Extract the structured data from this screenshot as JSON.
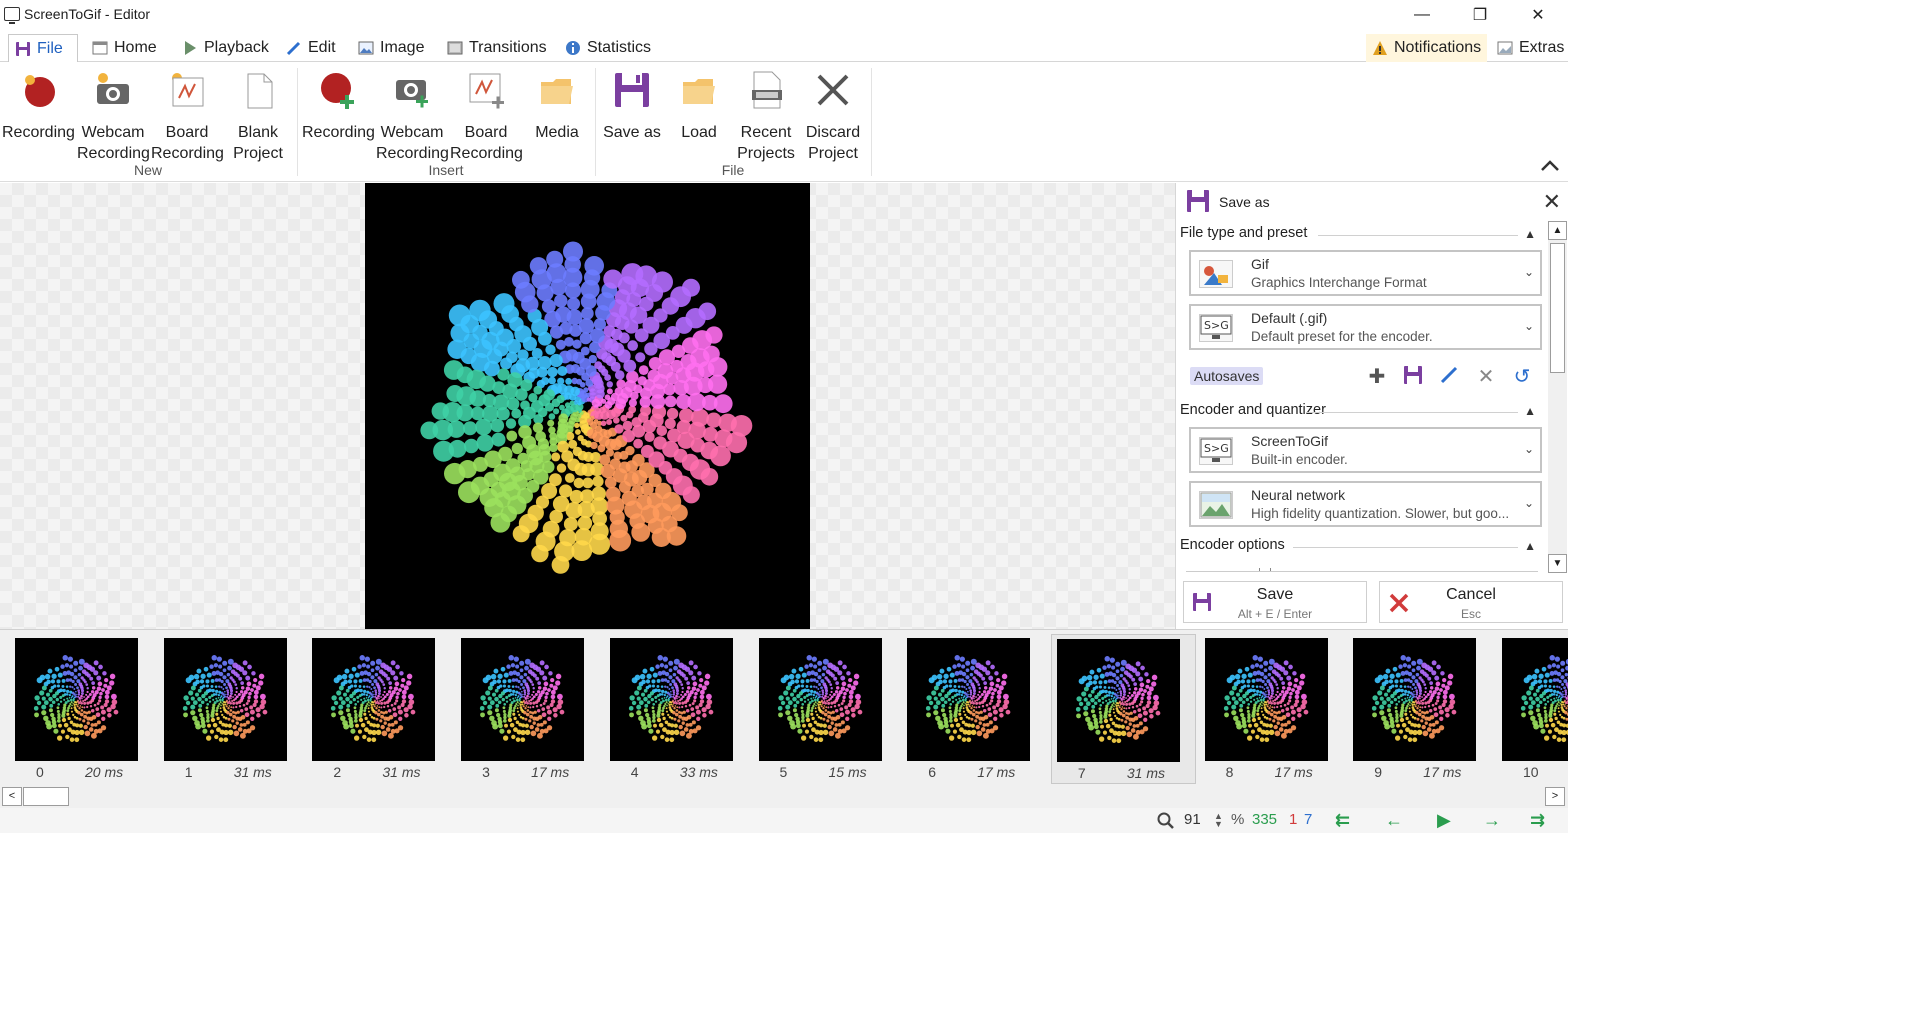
{
  "window": {
    "title": "ScreenToGif - Editor",
    "controls": [
      "—",
      "❐",
      "✕"
    ]
  },
  "tabs": [
    {
      "label": "File",
      "icon": "floppy-disk-icon"
    },
    {
      "label": "Home",
      "icon": "window-icon"
    },
    {
      "label": "Playback",
      "icon": "play-icon"
    },
    {
      "label": "Edit",
      "icon": "pencil-icon"
    },
    {
      "label": "Image",
      "icon": "image-icon"
    },
    {
      "label": "Transitions",
      "icon": "transition-icon"
    },
    {
      "label": "Statistics",
      "icon": "info-icon"
    }
  ],
  "header_right": {
    "notifications": "Notifications",
    "extras": "Extras"
  },
  "ribbon": {
    "new_group": "New",
    "insert_group": "Insert",
    "file_group": "File",
    "new": [
      {
        "l1": "Recording",
        "l2": ""
      },
      {
        "l1": "Webcam",
        "l2": "Recording"
      },
      {
        "l1": "Board",
        "l2": "Recording"
      },
      {
        "l1": "Blank",
        "l2": "Project"
      }
    ],
    "insert": [
      {
        "l1": "Recording",
        "l2": ""
      },
      {
        "l1": "Webcam",
        "l2": "Recording"
      },
      {
        "l1": "Board",
        "l2": "Recording"
      },
      {
        "l1": "Media",
        "l2": ""
      }
    ],
    "file": [
      {
        "l1": "Save as",
        "l2": ""
      },
      {
        "l1": "Load",
        "l2": ""
      },
      {
        "l1": "Recent",
        "l2": "Projects"
      },
      {
        "l1": "Discard",
        "l2": "Project"
      }
    ]
  },
  "panel": {
    "title": "Save as",
    "file_type_section": "File type and preset",
    "file_type": {
      "name": "Gif",
      "desc": "Graphics Interchange Format"
    },
    "preset": {
      "name": "Default (.gif)",
      "desc": "Default preset for the encoder."
    },
    "autosaves": "Autosaves",
    "encoder_section": "Encoder and quantizer",
    "encoder": {
      "name": "ScreenToGif",
      "desc": "Built-in encoder."
    },
    "quantizer": {
      "name": "Neural network",
      "desc": "High fidelity quantization. Slower, but goo..."
    },
    "encoder_options_section": "Encoder options",
    "save": {
      "label": "Save",
      "shortcut": "Alt + E / Enter"
    },
    "cancel": {
      "label": "Cancel",
      "shortcut": "Esc"
    }
  },
  "frames": [
    {
      "num": "0",
      "dur": "20 ms"
    },
    {
      "num": "1",
      "dur": "31 ms"
    },
    {
      "num": "2",
      "dur": "31 ms"
    },
    {
      "num": "3",
      "dur": "17 ms"
    },
    {
      "num": "4",
      "dur": "33 ms"
    },
    {
      "num": "5",
      "dur": "15 ms"
    },
    {
      "num": "6",
      "dur": "17 ms"
    },
    {
      "num": "7",
      "dur": "31 ms"
    },
    {
      "num": "8",
      "dur": "17 ms"
    },
    {
      "num": "9",
      "dur": "17 ms"
    },
    {
      "num": "10",
      "dur": ""
    }
  ],
  "selected_frame": "7",
  "status": {
    "zoom": "91",
    "percent": "%",
    "total_frames": "335",
    "selected_count": "1",
    "current_frame": "7"
  }
}
